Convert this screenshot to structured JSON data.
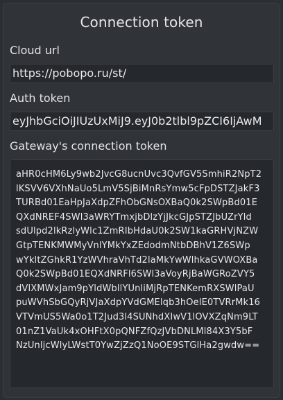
{
  "dialog": {
    "title": "Connection token"
  },
  "cloud_url": {
    "label": "Cloud url",
    "value": "https://pobopo.ru/st/"
  },
  "auth_token": {
    "label": "Auth token",
    "value": "eyJhbGciOiJIUzUxMiJ9.eyJ0b2tlbl9pZCI6IjAwM"
  },
  "gateway_token": {
    "label": "Gateway's connection token",
    "lines": [
      "aHR0cHM6Ly9wb2JvcG8ucnUvc3QvfGV5SmhiR2NpT2",
      "lKSVV6VXhNaUo5LmV5SjBiMnRsYmw5cFpDSTZJakF3",
      "TURBd01EaHpJaXdpZFhObGNsOXBaQ0k2SWpBd01E",
      "QXdNREF4SWl3aWRYTmxjbDlzYjJkcGJpSTZJbUZrYld",
      "sdUlpd2lkRzlyWlc1ZmRIbHdaU0k2SW1kaGRHVjNZW",
      "GtpTENKMWMyVnlYMkYxZEdodmNtbDBhV1Z6SWp",
      "wYkltZGhkR1YzWVhraVhTd2laMkYwWlhkaGVWOXBa",
      "Q0k2SWpBd01EQXdNRFl6SWl3aVoyRjBaWGRoZVY5",
      "dVlXMWxJam9pYldWbllYUnliMjRpTENKemRXSWlPaU",
      "puWVhSbGQyRjVJaXdpYVdGMElqb3hOelE0TVRrMk16",
      "VTVmUS5Wa0o1T2Jud3l4SUNhdXIwV1lOVXZqNm9LT",
      "01nZ1VaUk4xOHFtX0pQNFZfQzJVbDNLMl84X3Y5bF",
      "NzUnljcWlyLWstT0YwZjZzQ1NoOE9STGlHa2gwdw=="
    ]
  }
}
